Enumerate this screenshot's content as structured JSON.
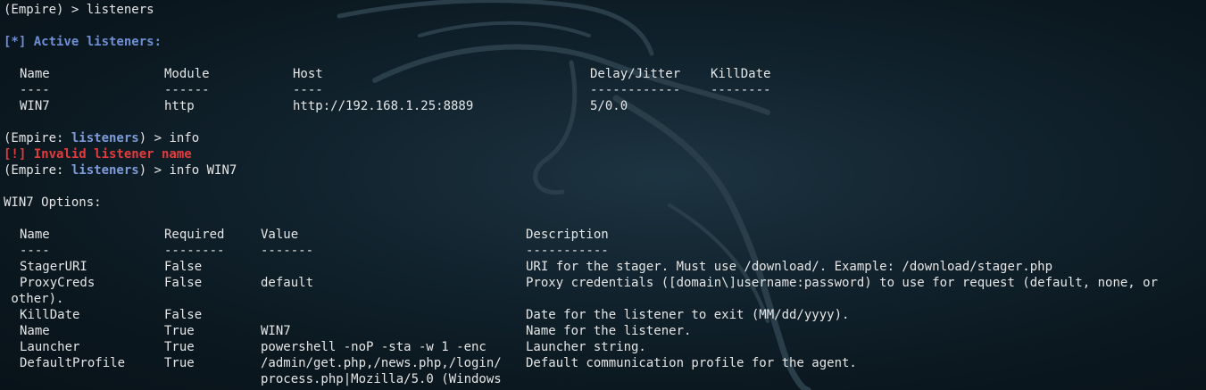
{
  "commands": {
    "listeners_cmd": "(Empire) > listeners",
    "active_listeners_header": "[*] Active listeners:",
    "prompt_open": "(Empire: ",
    "prompt_context": "listeners",
    "prompt_close": ") > ",
    "cmd_info": "info",
    "error_invalid": "[!] Invalid listener name",
    "cmd_info_win7": "info WIN7"
  },
  "listeners_table": {
    "headers": [
      "Name",
      "Module",
      "Host",
      "Delay/Jitter",
      "KillDate"
    ],
    "separators": [
      "----",
      "------",
      "----",
      "------------",
      "--------"
    ],
    "rows": [
      [
        "WIN7",
        "http",
        "http://192.168.1.25:8889",
        "5/0.0",
        ""
      ]
    ]
  },
  "options": {
    "title": "WIN7 Options:",
    "headers": [
      "Name",
      "Required",
      "Value",
      "Description"
    ],
    "separators": [
      "----",
      "--------",
      "-------",
      "-----------"
    ],
    "rows": [
      [
        "StagerURI",
        "False",
        "",
        "URI for the stager. Must use /download/. Example: /download/stager.php"
      ],
      [
        "ProxyCreds",
        "False",
        "default",
        "Proxy credentials ([domain\\]username:password) to use for request (default, none, or"
      ],
      [
        "KillDate",
        "False",
        "",
        "Date for the listener to exit (MM/dd/yyyy)."
      ],
      [
        "Name",
        "True",
        "WIN7",
        "Name for the listener."
      ],
      [
        "Launcher",
        "True",
        "powershell -noP -sta -w 1 -enc",
        "Launcher string."
      ],
      [
        "DefaultProfile",
        "True",
        "/admin/get.php,/news.php,/login/",
        "Default communication profile for the agent."
      ]
    ],
    "proxycreds_wrap": " other).",
    "defaultprofile_wrap": "process.php|Mozilla/5.0 (Windows"
  }
}
